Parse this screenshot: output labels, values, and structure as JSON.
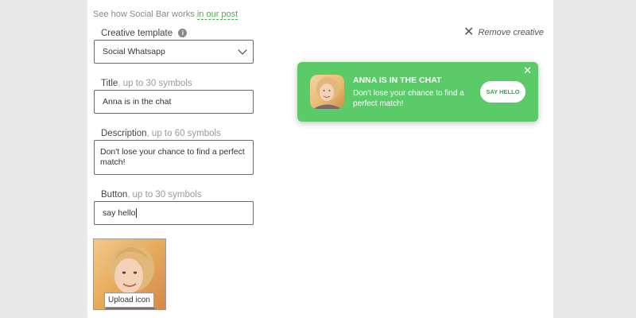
{
  "intro": {
    "text": "See how Social Bar works ",
    "link": "in our post"
  },
  "template": {
    "label": "Creative template",
    "value": "Social Whatsapp"
  },
  "title": {
    "label": "Title",
    "hint": ", up to 30 symbols",
    "value": "Anna is in the chat"
  },
  "description": {
    "label": "Description",
    "hint": ", up to 60 symbols",
    "value": "Don't lose your chance to find a perfect match!"
  },
  "button": {
    "label": "Button",
    "hint": ", up to 30 symbols",
    "value": "say hello"
  },
  "upload": {
    "label": "Upload icon"
  },
  "remove": {
    "label": "Remove creative"
  },
  "preview": {
    "title": "ANNA IS IN THE CHAT",
    "description": "Don't lose your chance to find a perfect match!",
    "button": "SAY HELLO",
    "close": "✕",
    "color": "#5bcb6a"
  }
}
